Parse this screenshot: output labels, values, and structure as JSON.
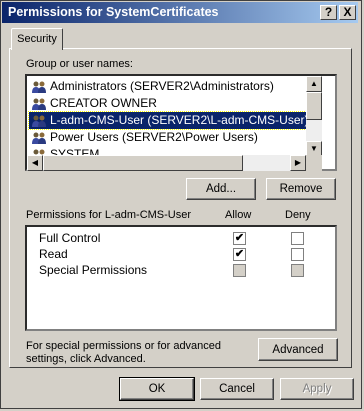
{
  "window": {
    "title": "Permissions for SystemCertificates",
    "help_button": "?",
    "close_button": "X"
  },
  "tabs": [
    {
      "label": "Security"
    }
  ],
  "group_list": {
    "label": "Group or user names:",
    "items": [
      {
        "name": "Administrators (SERVER2\\Administrators)",
        "selected": false
      },
      {
        "name": "CREATOR OWNER",
        "selected": false
      },
      {
        "name": "L-adm-CMS-User (SERVER2\\L-adm-CMS-User)",
        "selected": true
      },
      {
        "name": "Power Users (SERVER2\\Power Users)",
        "selected": false
      },
      {
        "name": "SYSTEM",
        "selected": false
      }
    ]
  },
  "buttons": {
    "add": "Add...",
    "remove": "Remove",
    "advanced": "Advanced",
    "ok": "OK",
    "cancel": "Cancel",
    "apply": "Apply"
  },
  "permissions": {
    "header": "Permissions for L-adm-CMS-User",
    "allow_header": "Allow",
    "deny_header": "Deny",
    "rows": [
      {
        "name": "Full Control",
        "allow": true,
        "deny": false,
        "disabled": false
      },
      {
        "name": "Read",
        "allow": true,
        "deny": false,
        "disabled": false
      },
      {
        "name": "Special Permissions",
        "allow": false,
        "deny": false,
        "disabled": true
      }
    ]
  },
  "advanced_note": "For special permissions or for advanced settings, click Advanced."
}
